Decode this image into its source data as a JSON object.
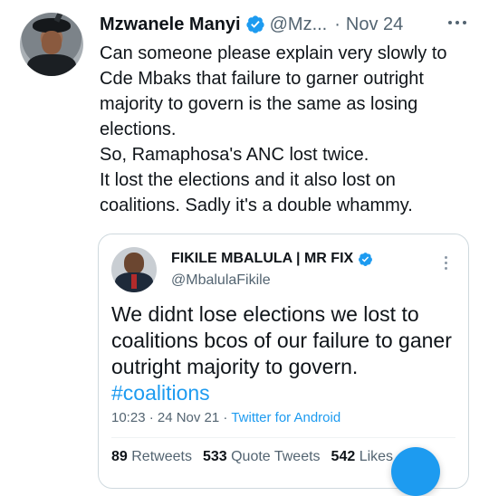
{
  "author": {
    "name": "Mzwanele Manyi",
    "handle": "@Mz...",
    "separator": "·",
    "date": "Nov 24"
  },
  "tweet": {
    "lines": [
      "Can someone please explain very slowly to",
      "Cde Mbaks that failure to garner outright",
      "majority to govern is the same as losing",
      "elections.",
      "So, Ramaphosa's ANC lost twice.",
      "It lost the elections and it also lost on",
      "coalitions. Sadly it's a double whammy."
    ]
  },
  "quoted": {
    "name": "FIKILE MBALULA | MR FIX",
    "handle": "@MbalulaFikile",
    "lines": [
      "We didnt lose elections we lost to",
      "coalitions bcos of our failure to ganer",
      "outright majority to govern."
    ],
    "hashtag": "#coalitions",
    "timestamp": "10:23 · 24 Nov 21 · ",
    "source": "Twitter for Android",
    "retweets_count": "89",
    "retweets_label": "Retweets",
    "quotes_count": "533",
    "quotes_label": "Quote Tweets",
    "likes_count": "542",
    "likes_label": "Likes"
  },
  "colors": {
    "accent": "#1d9bf0",
    "text": "#0f1419",
    "muted": "#536471",
    "border": "#cfd9de"
  },
  "icons": {
    "verified": "verified-badge-icon",
    "more": "more-options-icon"
  }
}
